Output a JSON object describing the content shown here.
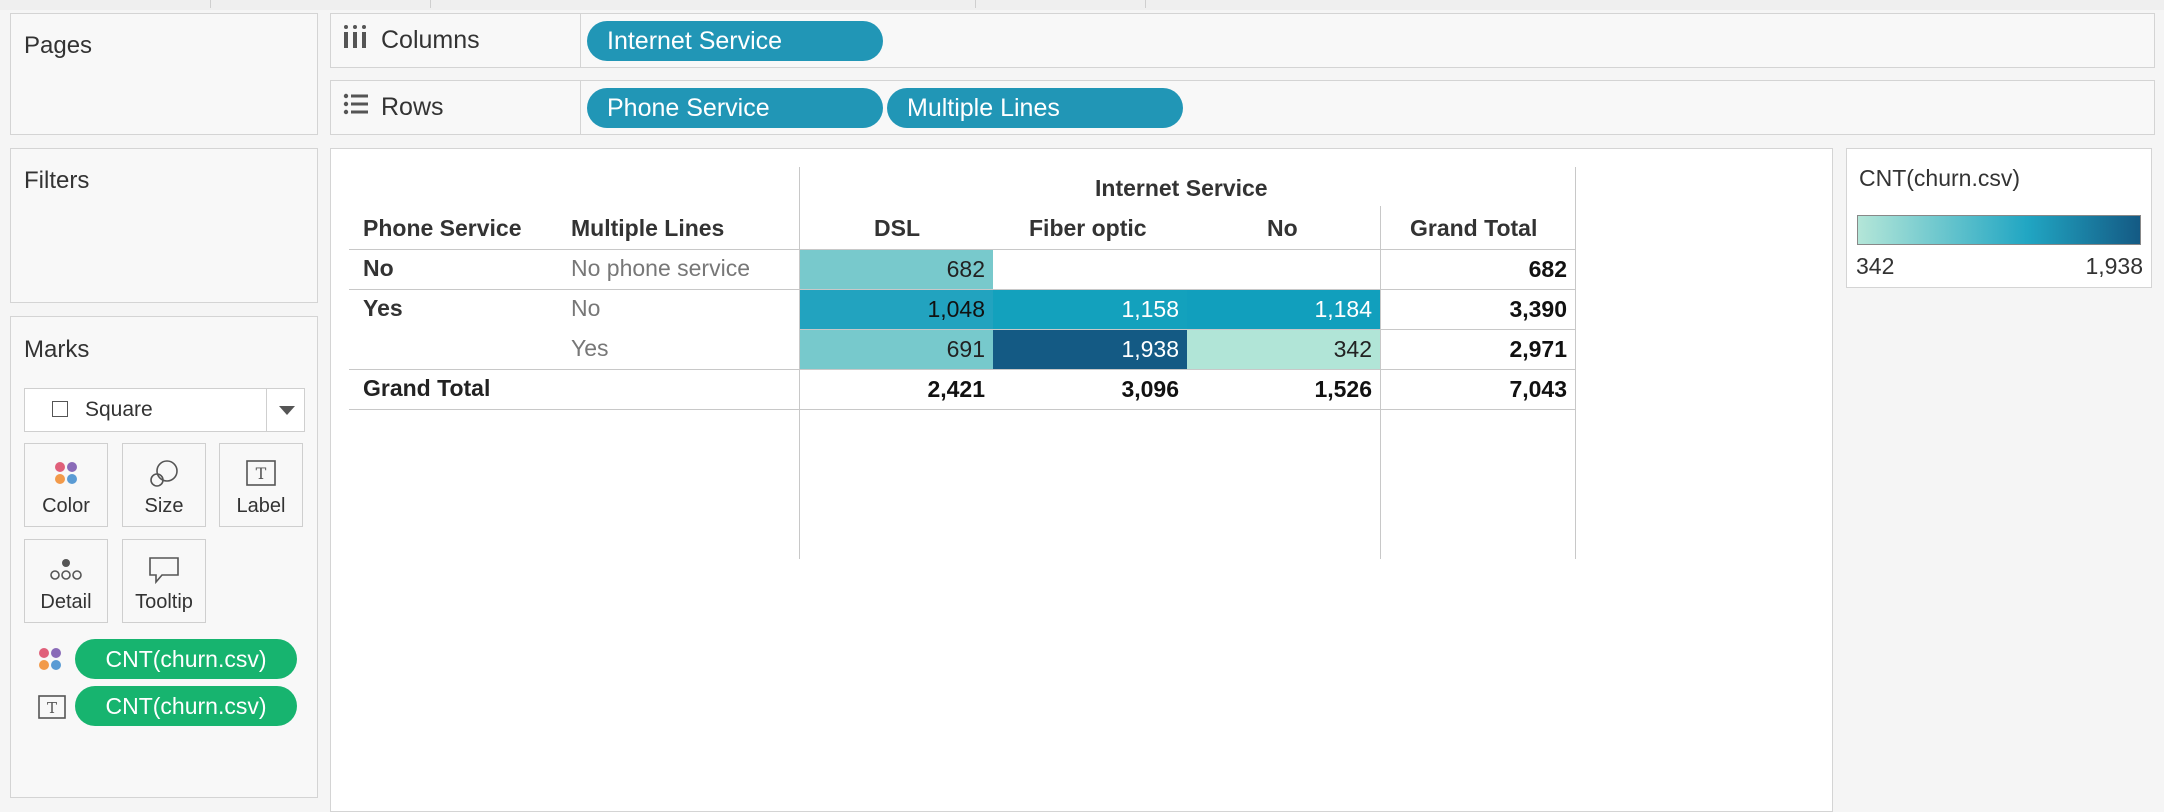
{
  "shelves": {
    "pages_label": "Pages",
    "columns_label": "Columns",
    "rows_label": "Rows",
    "filters_label": "Filters",
    "column_pills": [
      "Internet Service"
    ],
    "row_pills": [
      "Phone Service",
      "Multiple Lines"
    ]
  },
  "marks": {
    "title": "Marks",
    "type": "Square",
    "buttons": [
      "Color",
      "Size",
      "Label",
      "Detail",
      "Tooltip"
    ],
    "fields": [
      "CNT(churn.csv)",
      "CNT(churn.csv)"
    ]
  },
  "table": {
    "col_group_header": "Internet Service",
    "row_headers": [
      "Phone Service",
      "Multiple Lines"
    ],
    "col_headers": [
      "DSL",
      "Fiber optic",
      "No",
      "Grand Total"
    ],
    "rows": [
      {
        "phone": "No",
        "lines": "No phone service",
        "values": [
          "682",
          "",
          ""
        ],
        "total": "682"
      },
      {
        "phone": "Yes",
        "lines": "No",
        "values": [
          "1,048",
          "1,158",
          "1,184"
        ],
        "total": "3,390"
      },
      {
        "phone": "",
        "lines": "Yes",
        "values": [
          "691",
          "1,938",
          "342"
        ],
        "total": "2,971"
      }
    ],
    "grand_total_label": "Grand Total",
    "grand_totals": [
      "2,421",
      "3,096",
      "1,526",
      "7,043"
    ]
  },
  "legend": {
    "title": "CNT(churn.csv)",
    "min": "342",
    "max": "1,938",
    "colors": {
      "low": "#b4e6d8",
      "mid": "#21a6c3",
      "high": "#145a84"
    }
  },
  "cell_colors": [
    [
      "#78c9cc",
      null,
      null
    ],
    [
      "#22a3bf",
      "#13a1bd",
      "#119fbd"
    ],
    [
      "#77c9cc",
      "#145a84",
      "#b1e5d7"
    ]
  ]
}
